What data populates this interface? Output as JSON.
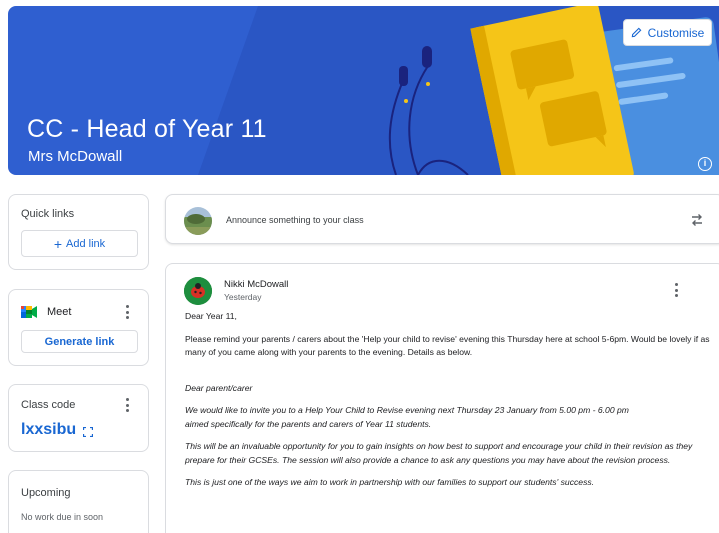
{
  "banner": {
    "title": "CC - Head of Year 11",
    "subtitle": "Mrs McDowall",
    "customise_label": "Customise",
    "colors": {
      "background": "#2f5fd0",
      "book": "#f5c518",
      "notebook": "#4a90e2"
    }
  },
  "sidebar": {
    "quick_links": {
      "title": "Quick links",
      "add_label": "Add link"
    },
    "meet": {
      "title": "Meet",
      "generate_label": "Generate link"
    },
    "class_code": {
      "title": "Class code",
      "value": "lxxsibu"
    },
    "upcoming": {
      "title": "Upcoming",
      "empty_text": "No work due in soon"
    }
  },
  "announce": {
    "prompt": "Announce something to your class"
  },
  "post": {
    "author": "Nikki McDowall",
    "time": "Yesterday",
    "greeting": "Dear Year 11,",
    "paragraph1": "Please remind your parents / carers about the 'Help your child to revise' evening this Thursday here at school 5-6pm. Would be lovely if as many of you came along with your parents to the evening. Details as below.",
    "letter_salutation": "Dear parent/carer",
    "letter_p1_line1": "We would like to invite you to a Help Your Child to Revise evening next Thursday 23 January from 5.00 pm - 6.00 pm",
    "letter_p1_line2": "aimed specifically for the parents and carers of Year 11 students.",
    "letter_p2": "This will be an invaluable opportunity for you to gain insights on how best to support and encourage your child in their revision as they prepare for their GCSEs. The session will also provide a chance to ask any questions you may have about the revision process.",
    "letter_p3": "This is just one of the ways we aim to work in partnership with our families to support our students' success."
  }
}
